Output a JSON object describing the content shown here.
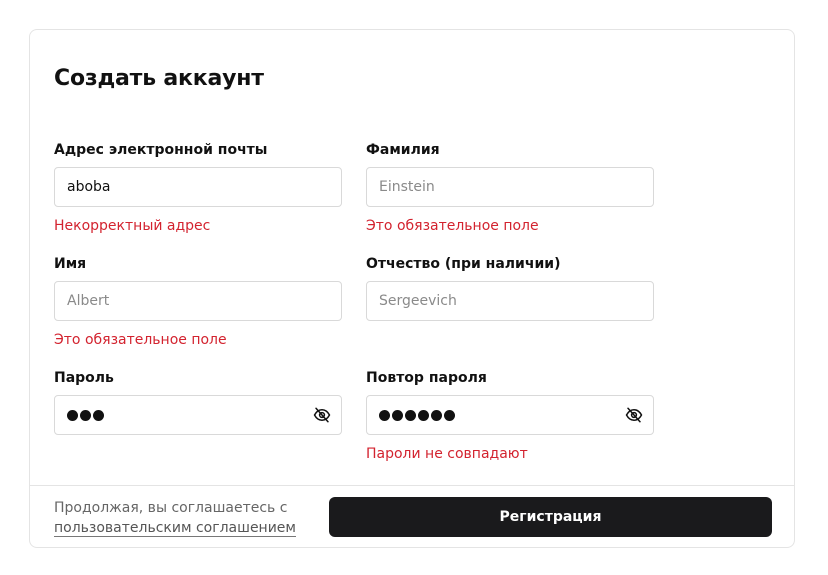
{
  "form": {
    "title": "Создать аккаунт",
    "fields": {
      "email": {
        "label": "Адрес электронной почты",
        "value": "aboba",
        "placeholder": "",
        "error": "Некорректный адрес"
      },
      "last_name": {
        "label": "Фамилия",
        "value": "",
        "placeholder": "Einstein",
        "error": "Это обязательное поле"
      },
      "first_name": {
        "label": "Имя",
        "value": "",
        "placeholder": "Albert",
        "error": "Это обязательное поле"
      },
      "patronymic": {
        "label": "Отчество (при наличии)",
        "value": "",
        "placeholder": "Sergeevich",
        "error": ""
      },
      "password": {
        "label": "Пароль",
        "masked_length": 3,
        "toggle_icon": "eye-off-icon",
        "error": ""
      },
      "password_repeat": {
        "label": "Повтор пароля",
        "masked_length": 6,
        "toggle_icon": "eye-off-icon",
        "error": "Пароли не совпадают"
      }
    },
    "footer": {
      "agreement_text": "Продолжая, вы соглашаетесь с",
      "agreement_link": "пользовательским соглашением",
      "submit_label": "Регистрация"
    }
  },
  "colors": {
    "error": "#d3232f",
    "button_bg": "#1a1a1c",
    "border": "#d9d9d9"
  }
}
